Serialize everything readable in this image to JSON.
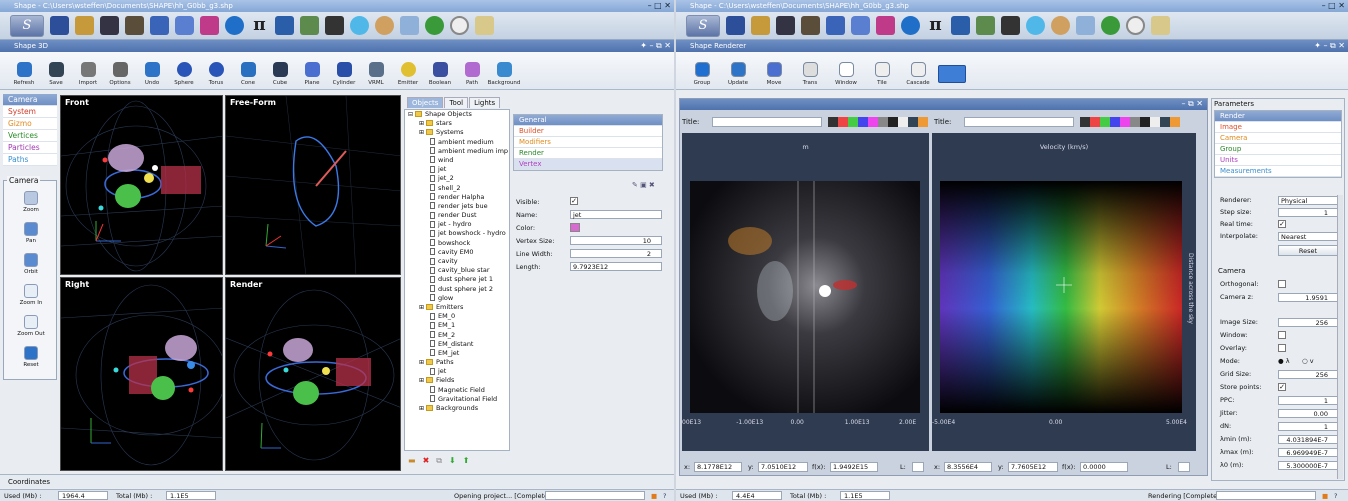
{
  "left_window": {
    "title": "Shape - C:\\Users\\wsteffen\\Documents\\SHAPE\\hh_G0bb_g3.shp",
    "panel_title": "Shape 3D",
    "toolbar": [
      "Refresh",
      "Save",
      "Import",
      "Options",
      "Undo",
      "Sphere",
      "Torus",
      "Cone",
      "Cube",
      "Plane",
      "Cylinder",
      "VRML",
      "Emitter",
      "Boolean",
      "Path",
      "Background"
    ],
    "nav": [
      "Camera",
      "System",
      "Gizmo",
      "Vertices",
      "Particles",
      "Paths"
    ],
    "camera_group": {
      "title": "Camera",
      "tools": [
        "Zoom",
        "Pan",
        "Orbit",
        "Zoom In",
        "Zoom Out",
        "Reset"
      ]
    },
    "viewports": [
      "Front",
      "Free-Form",
      "Right",
      "Render"
    ],
    "tabs": [
      "Objects",
      "Tool",
      "Lights"
    ],
    "tree": [
      {
        "t": "Shape Objects",
        "lvl": 0,
        "kind": "folder"
      },
      {
        "t": "stars",
        "lvl": 1,
        "kind": "folder"
      },
      {
        "t": "Systems",
        "lvl": 1,
        "kind": "folder"
      },
      {
        "t": "ambient medium",
        "lvl": 2,
        "kind": "doc"
      },
      {
        "t": "ambient medium imp",
        "lvl": 2,
        "kind": "doc"
      },
      {
        "t": "wind",
        "lvl": 2,
        "kind": "doc"
      },
      {
        "t": "jet",
        "lvl": 2,
        "kind": "doc"
      },
      {
        "t": "jet_2",
        "lvl": 2,
        "kind": "doc"
      },
      {
        "t": "shell_2",
        "lvl": 2,
        "kind": "doc"
      },
      {
        "t": "render Halpha",
        "lvl": 2,
        "kind": "doc"
      },
      {
        "t": "render jets bue",
        "lvl": 2,
        "kind": "doc"
      },
      {
        "t": "render Dust",
        "lvl": 2,
        "kind": "doc"
      },
      {
        "t": "jet - hydro",
        "lvl": 2,
        "kind": "doc"
      },
      {
        "t": "jet bowshock - hydro",
        "lvl": 2,
        "kind": "doc"
      },
      {
        "t": "bowshock",
        "lvl": 2,
        "kind": "doc"
      },
      {
        "t": "cavity EM0",
        "lvl": 2,
        "kind": "doc"
      },
      {
        "t": "cavity",
        "lvl": 2,
        "kind": "doc"
      },
      {
        "t": "cavity_blue star",
        "lvl": 2,
        "kind": "doc"
      },
      {
        "t": "dust sphere jet 1",
        "lvl": 2,
        "kind": "doc"
      },
      {
        "t": "dust sphere jet 2",
        "lvl": 2,
        "kind": "doc"
      },
      {
        "t": "glow",
        "lvl": 2,
        "kind": "doc"
      },
      {
        "t": "Emitters",
        "lvl": 1,
        "kind": "folder"
      },
      {
        "t": "EM_0",
        "lvl": 2,
        "kind": "doc"
      },
      {
        "t": "EM_1",
        "lvl": 2,
        "kind": "doc"
      },
      {
        "t": "EM_2",
        "lvl": 2,
        "kind": "doc"
      },
      {
        "t": "EM_distant",
        "lvl": 2,
        "kind": "doc"
      },
      {
        "t": "EM_jet",
        "lvl": 2,
        "kind": "doc"
      },
      {
        "t": "Paths",
        "lvl": 1,
        "kind": "folder"
      },
      {
        "t": "jet",
        "lvl": 2,
        "kind": "doc"
      },
      {
        "t": "Fields",
        "lvl": 1,
        "kind": "folder"
      },
      {
        "t": "Magnetic Field",
        "lvl": 2,
        "kind": "doc"
      },
      {
        "t": "Gravitational Field",
        "lvl": 2,
        "kind": "doc"
      },
      {
        "t": "Backgrounds",
        "lvl": 1,
        "kind": "folder"
      }
    ],
    "categories": [
      "General",
      "Builder",
      "Modifiers",
      "Render",
      "Vertex"
    ],
    "props": {
      "visible_label": "Visible:",
      "name_label": "Name:",
      "name_value": "jet",
      "color_label": "Color:",
      "vertex_size_label": "Vertex Size:",
      "vertex_size": "10",
      "line_width_label": "Line Width:",
      "line_width": "2",
      "length_label": "Length:",
      "length": "9.7923E12"
    },
    "coords_label": "Coordinates",
    "status": {
      "used_label": "Used (Mb) :",
      "used": "1964.4",
      "total_label": "Total (Mb) :",
      "total": "1.1E5",
      "message": "Opening project... [Complete]"
    }
  },
  "right_window": {
    "title": "Shape - C:\\Users\\wsteffen\\Documents\\SHAPE\\hh_G0bb_g3.shp",
    "panel_title": "Shape Renderer",
    "toolbar": [
      "Group",
      "Update",
      "Move",
      "Trans",
      "Window",
      "Tile",
      "Cascade"
    ],
    "plot1": {
      "title_label": "Title:",
      "top_label": "m",
      "xticks": [
        "00E13",
        "-1.00E13",
        "0.00",
        "1.00E13",
        "2.00E"
      ],
      "x_label": "x:",
      "x": "8.1778E12",
      "y_label": "y:",
      "y": "7.0510E12",
      "f_label": "f(x):",
      "f": "1.9492E15",
      "l_label": "L:"
    },
    "plot2": {
      "title_label": "Title:",
      "top_label": "Velocity (km/s)",
      "xticks": [
        "-5.00E4",
        "0.00",
        "5.00E4"
      ],
      "x_label": "x:",
      "x": "8.3556E4",
      "y_label": "y:",
      "y": "7.7605E12",
      "f_label": "f(x):",
      "f": "0.0000",
      "l_label": "L:",
      "side_label": "Distance across the sky"
    },
    "params_title": "Parameters",
    "param_tabs": [
      "Render",
      "Image",
      "Camera",
      "Group",
      "Units",
      "Measurements"
    ],
    "params": {
      "renderer_label": "Renderer:",
      "renderer": "Physical",
      "step_label": "Step size:",
      "step": "1",
      "realtime_label": "Real time:",
      "interp_label": "Interpolate:",
      "interp": "Nearest",
      "reset": "Reset",
      "camera_section": "Camera",
      "ortho_label": "Orthogonal:",
      "cam_z_label": "Camera z:",
      "cam_z": "1.9591",
      "image_size_label": "Image Size:",
      "image_size": "256",
      "window_label": "Window:",
      "overlay_label": "Overlay:",
      "mode_label": "Mode:",
      "mode_a": "λ",
      "mode_b": "v",
      "grid_label": "Grid Size:",
      "grid": "256",
      "store_label": "Store points:",
      "ppc_label": "PPC:",
      "ppc": "1",
      "jitter_label": "Jitter:",
      "jitter": "0.00",
      "dn_label": "dN:",
      "dn": "1",
      "lmin_label": "λmin (m):",
      "lmin": "4.031894E-7",
      "lmax_label": "λmax (m):",
      "lmax": "6.969949E-7",
      "l0_label": "λ0 (m):",
      "l0": "5.300000E-7"
    },
    "status": {
      "used_label": "Used (Mb) :",
      "used": "4.4E4",
      "total_label": "Total (Mb) :",
      "total": "1.1E5",
      "message": "Rendering [Complete]"
    }
  },
  "colors": {
    "accent": "#6f8fc5",
    "nav_system": "#d23c2a",
    "nav_gizmo": "#e08a1c",
    "nav_vertices": "#2a8a2a",
    "nav_particles": "#a03ab0",
    "nav_paths": "#3a8fd0"
  }
}
